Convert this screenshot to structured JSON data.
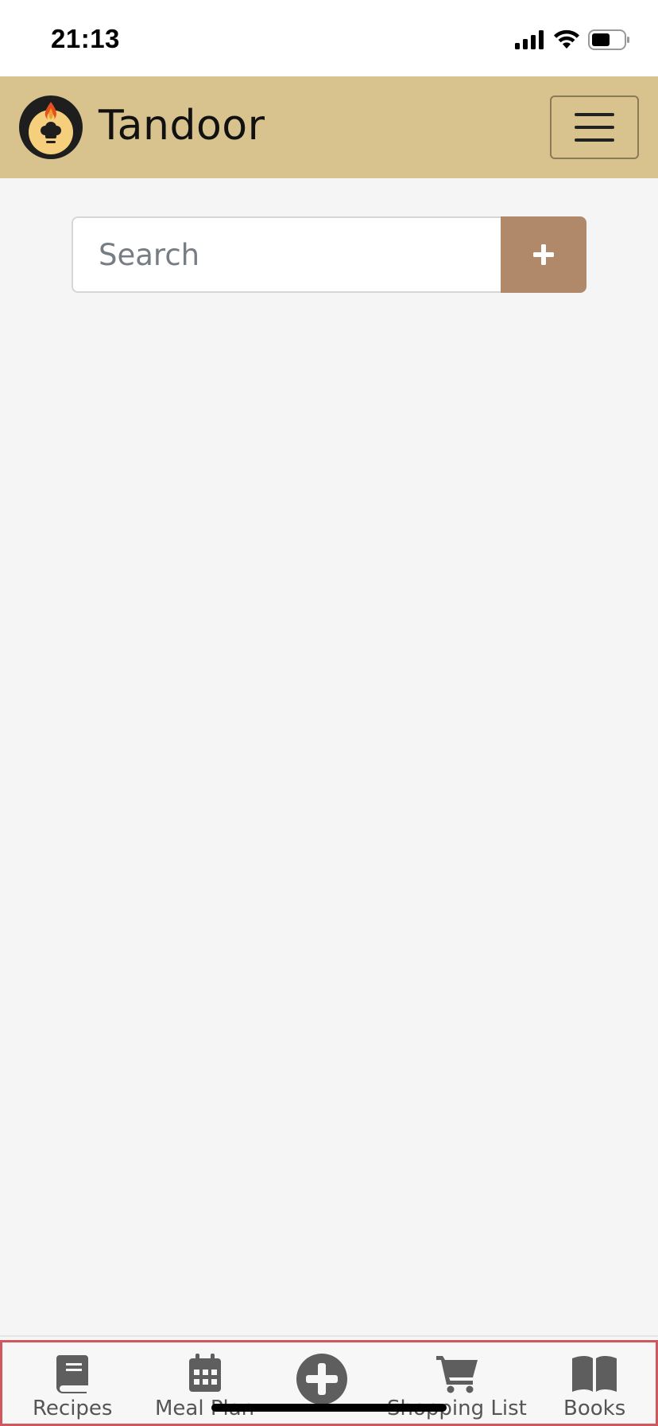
{
  "status_bar": {
    "time": "21:13"
  },
  "navbar": {
    "brand_name": "Tandoor",
    "colors": {
      "background": "#d8c28d",
      "accent": "#b0896b"
    }
  },
  "search": {
    "placeholder": "Search",
    "add_label": "+"
  },
  "bottom_nav": {
    "items": [
      {
        "label": "Recipes",
        "icon": "book-icon"
      },
      {
        "label": "Meal Plan",
        "icon": "calendar-icon"
      },
      {
        "label": "",
        "icon": "plus-circle-icon"
      },
      {
        "label": "Shopping List",
        "icon": "cart-icon"
      },
      {
        "label": "Books",
        "icon": "open-book-icon"
      }
    ]
  }
}
